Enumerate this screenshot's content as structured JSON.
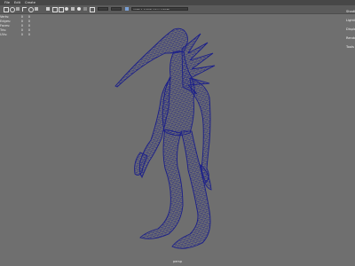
{
  "menu": [
    "File",
    "Edit",
    "Create",
    "Select",
    "Modify",
    "Display",
    "Windows",
    "Mesh",
    "Edit Mesh",
    "Mesh Tools",
    "Mesh Display",
    "Curves",
    "Surfaces",
    "Deform",
    "UV",
    "Generate",
    "Cache",
    "Arnold",
    "Help"
  ],
  "toolbar": {
    "field_1": "",
    "field_2": "",
    "camera_field": "ACES 1.0 SDR-video (sRGB)"
  },
  "hud": {
    "rows": [
      {
        "label": "Verts:",
        "v1": "0",
        "v2": "0"
      },
      {
        "label": "Edges:",
        "v1": "0",
        "v2": "0"
      },
      {
        "label": "Faces:",
        "v1": "0",
        "v2": "0"
      },
      {
        "label": "Tris:",
        "v1": "0",
        "v2": "0"
      },
      {
        "label": "UVs:",
        "v1": "0",
        "v2": "0"
      }
    ]
  },
  "side_labels": [
    "Shading",
    "Lighting",
    "Display",
    "Render",
    "Tools"
  ],
  "viewport_label": "persp",
  "colors": {
    "background": "#6f6f6f",
    "wire": "#1b1f8a",
    "wire_fill": "#c8cae6"
  }
}
